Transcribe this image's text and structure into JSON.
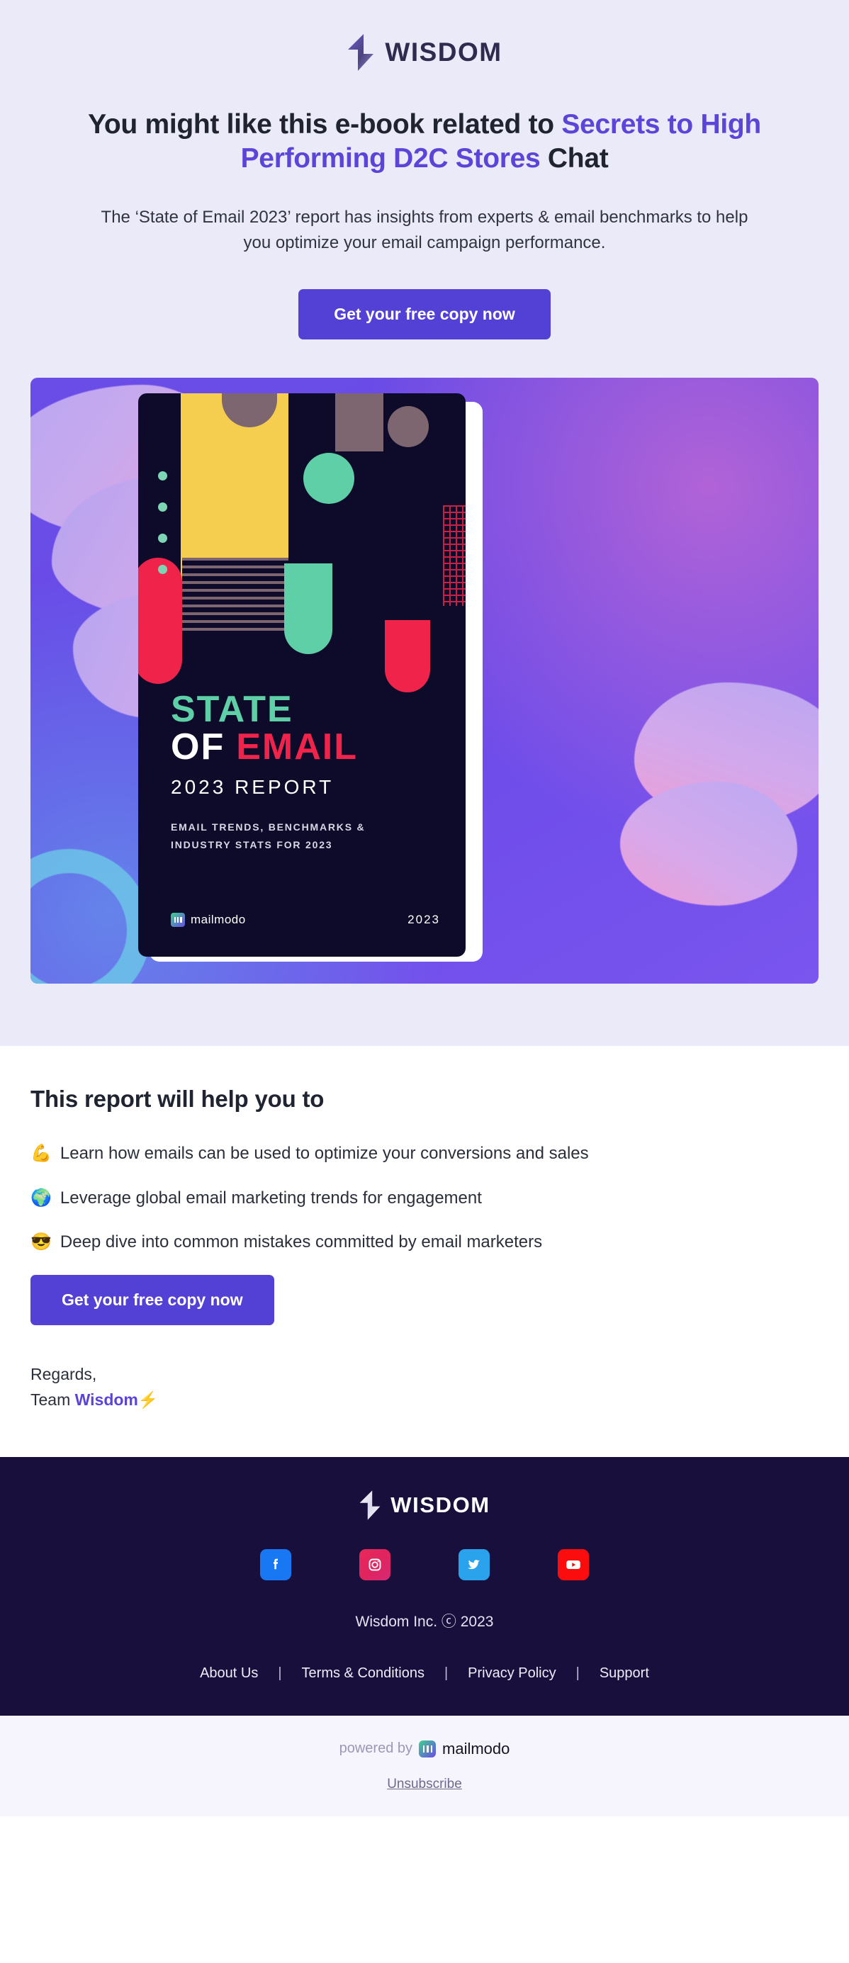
{
  "brand": {
    "name": "WISDOM",
    "logo_icon": "lightning-bolt-icon",
    "accent_color": "#5B45D8",
    "button_color": "#5341D6"
  },
  "hero": {
    "heading_prefix": "You might like this e-book related to ",
    "heading_accent": "Secrets to High Performing D2C Stores",
    "heading_suffix": " Chat",
    "subtext": "The ‘State of Email 2023’ report has insights from experts & email benchmarks to help you optimize your email campaign performance.",
    "cta_label": "Get your free copy now"
  },
  "book_cover": {
    "title_line1": "STATE",
    "title_of": "OF",
    "title_email": "EMAIL",
    "subtitle": "2023 REPORT",
    "blurb_line1": "EMAIL TRENDS, BENCHMARKS &",
    "blurb_line2": "INDUSTRY STATS FOR 2023",
    "publisher": "mailmodo",
    "year": "2023"
  },
  "body": {
    "title": "This report will help you to",
    "bullets": [
      {
        "emoji": "💪",
        "emoji_name": "flexed-biceps-icon",
        "text": "Learn how emails can be used to optimize your conversions and sales"
      },
      {
        "emoji": "🌍",
        "emoji_name": "globe-icon",
        "text": "Leverage global email marketing trends for engagement"
      },
      {
        "emoji": "😎",
        "emoji_name": "sunglasses-face-icon",
        "text": "Deep dive into common mistakes committed by email marketers"
      }
    ],
    "cta_label": "Get your free copy now",
    "regards_line": "Regards,",
    "team_prefix": "Team ",
    "team_name": "Wisdom",
    "team_emoji": "⚡"
  },
  "footer": {
    "brand_name": "WISDOM",
    "social": [
      {
        "name": "facebook-icon",
        "label": "Facebook",
        "color": "#1877F2"
      },
      {
        "name": "instagram-icon",
        "label": "Instagram",
        "color": "#D62976"
      },
      {
        "name": "twitter-icon",
        "label": "Twitter",
        "color": "#2BA3EC"
      },
      {
        "name": "youtube-icon",
        "label": "YouTube",
        "color": "#FB0D0D"
      }
    ],
    "copyright": "Wisdom Inc. ⓒ 2023",
    "links": [
      "About Us",
      "Terms & Conditions",
      "Privacy Policy",
      "Support"
    ],
    "separator": "|"
  },
  "powered": {
    "label": "powered by",
    "product": "mailmodo",
    "unsubscribe": "Unsubscribe"
  }
}
